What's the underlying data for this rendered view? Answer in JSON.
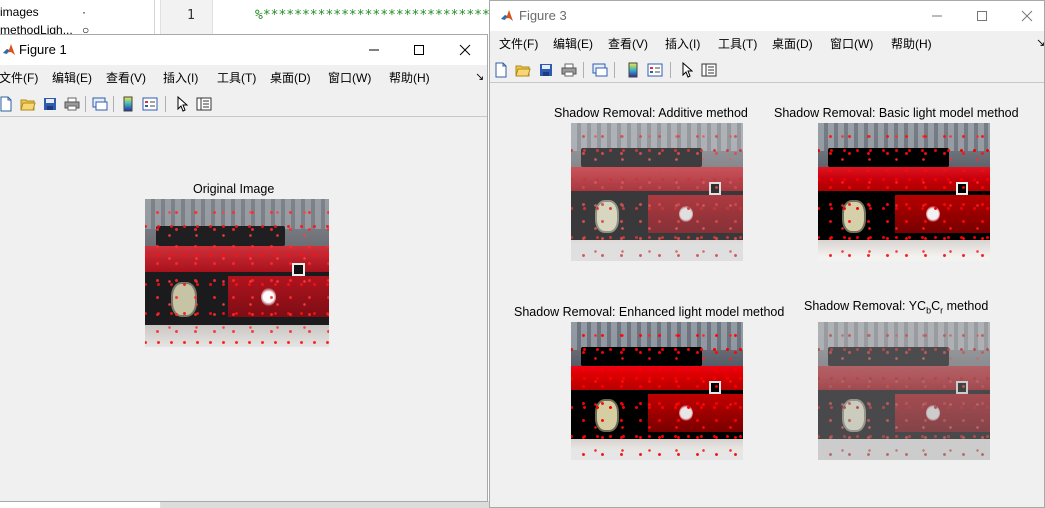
{
  "workspace": {
    "rows": [
      {
        "name": "images",
        "value": "·"
      },
      {
        "name": "methodLigh...",
        "value": "○"
      }
    ]
  },
  "editor": {
    "line_number": "1",
    "code": "%**********************************"
  },
  "figure1": {
    "title": "Figure 1",
    "menu": [
      "文件(F)",
      "编辑(E)",
      "查看(V)",
      "插入(I)",
      "工具(T)",
      "桌面(D)",
      "窗口(W)",
      "帮助(H)"
    ],
    "menu_more": "↘",
    "axes": [
      {
        "title": "Original Image"
      }
    ]
  },
  "figure3": {
    "title": "Figure 3",
    "menu": [
      "文件(F)",
      "编辑(E)",
      "查看(V)",
      "插入(I)",
      "工具(T)",
      "桌面(D)",
      "窗口(W)",
      "帮助(H)"
    ],
    "menu_more": "↘",
    "axes": [
      {
        "title": "Shadow Removal: Additive method"
      },
      {
        "title": "Shadow Removal: Basic light model method"
      },
      {
        "title": "Shadow Removal: Enhanced light model method"
      },
      {
        "title_prefix": "Shadow Removal: YC",
        "sub_b": "b",
        "mid": "C",
        "sub_r": "r",
        "suffix": " method"
      }
    ]
  },
  "icons": {
    "app": "matlab-icon",
    "toolbar": [
      "new-figure-icon",
      "open-file-icon",
      "save-icon",
      "print-icon",
      "link-plot-icon",
      "colorbar-icon",
      "legend-icon",
      "pointer-icon",
      "property-inspector-icon"
    ]
  },
  "colors": {
    "window_bg": "#f0f0f0",
    "titlebar_bg": "#ffffff",
    "comment_green": "#228b22",
    "feature_points": "#ff2a2a"
  }
}
